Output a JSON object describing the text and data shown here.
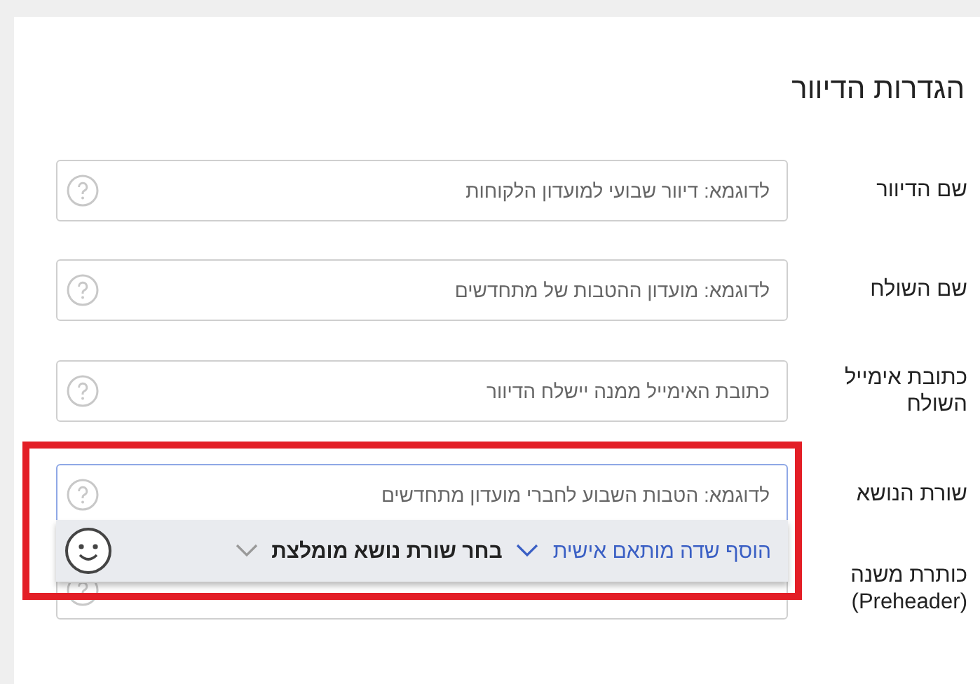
{
  "title": "הגדרות הדיוור",
  "fields": [
    {
      "label": "שם הדיוור",
      "placeholder": "לדוגמא: דיוור שבועי למועדון הלקוחות",
      "focused": false
    },
    {
      "label": "שם השולח",
      "placeholder": "לדוגמא: מועדון ההטבות של מתחדשים",
      "focused": false
    },
    {
      "label": "כתובת אימייל השולח",
      "placeholder": "כתובת האימייל ממנה יישלח הדיוור",
      "focused": false
    },
    {
      "label": "שורת הנושא",
      "placeholder": "לדוגמא: הטבות השבוע לחברי מועדון מתחדשים",
      "focused": true,
      "highlighted": true,
      "toolbar": {
        "personal_field": "הוסף שדה מותאם אישית",
        "recommended": "בחר שורת נושא מומלצת"
      }
    },
    {
      "label": "כותרת משנה (Preheader)",
      "focused": false
    }
  ]
}
